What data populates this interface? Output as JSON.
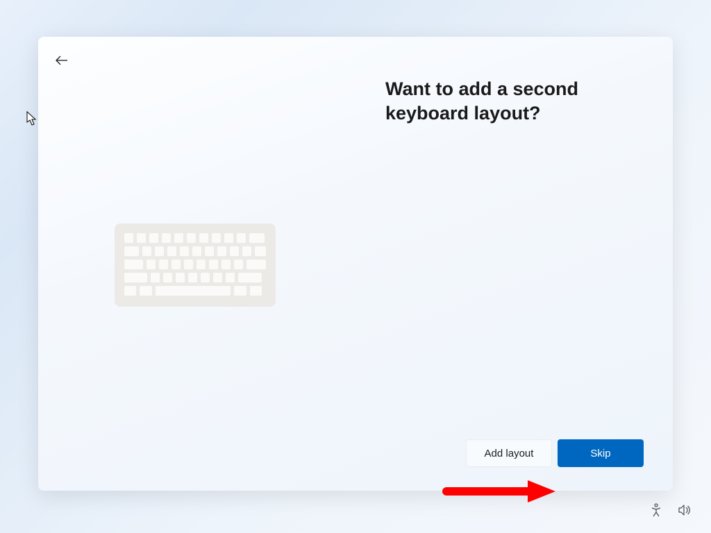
{
  "header": {
    "title": "Want to add a second keyboard layout?"
  },
  "buttons": {
    "add_layout": "Add layout",
    "skip": "Skip"
  },
  "icons": {
    "back": "back-arrow",
    "accessibility": "accessibility-icon",
    "volume": "volume-icon"
  }
}
